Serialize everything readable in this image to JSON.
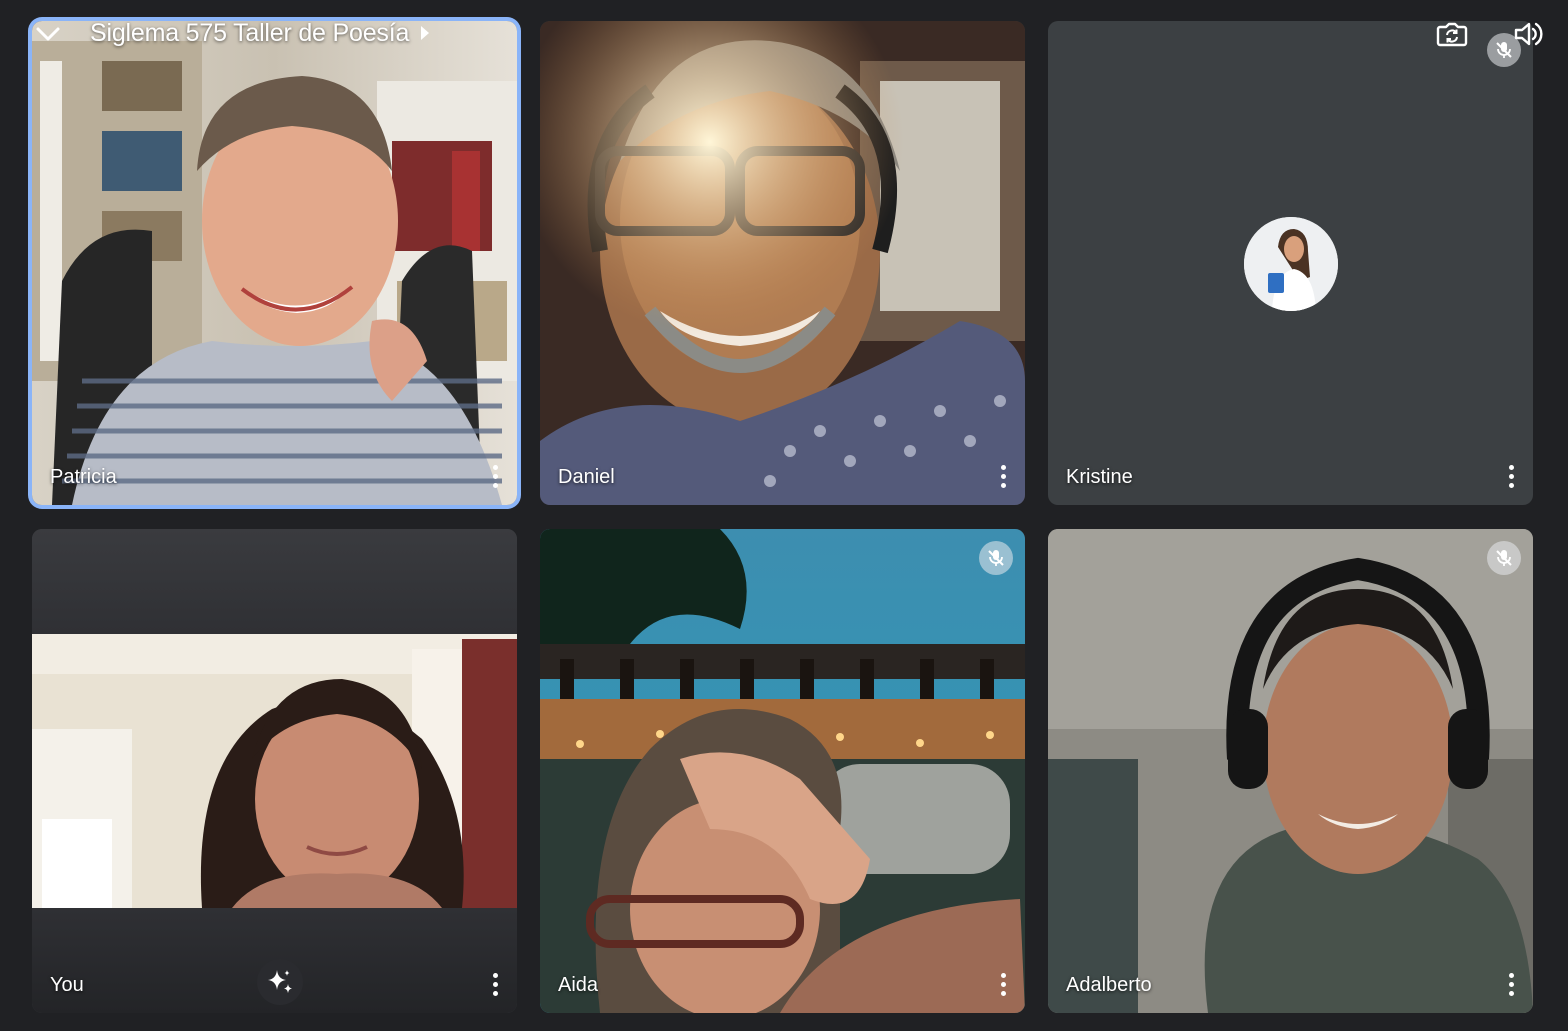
{
  "meeting": {
    "title": "Siglema 575 Taller de Poesía"
  },
  "top_controls": {
    "collapse_icon": "chevron-down-icon",
    "title_expand_icon": "caret-right-icon",
    "camera_switch_icon": "camera-switch-icon",
    "speaker_icon": "speaker-volume-icon"
  },
  "participants": [
    {
      "name": "Patricia",
      "active_speaker": true,
      "muted": false,
      "video_on": true
    },
    {
      "name": "Daniel",
      "active_speaker": false,
      "muted": false,
      "video_on": true
    },
    {
      "name": "Kristine",
      "active_speaker": false,
      "muted": true,
      "video_on": false,
      "avatar": "profile-photo"
    },
    {
      "name": "You",
      "active_speaker": false,
      "muted": false,
      "video_on": true,
      "effects_icon": "sparkle-effects-icon"
    },
    {
      "name": "Aida",
      "active_speaker": false,
      "muted": true,
      "video_on": true
    },
    {
      "name": "Adalberto",
      "active_speaker": false,
      "muted": true,
      "video_on": true
    }
  ],
  "colors": {
    "background": "#202124",
    "tile_background": "#3c4043",
    "active_border": "#8ab4f8",
    "label_text": "#ffffff"
  }
}
